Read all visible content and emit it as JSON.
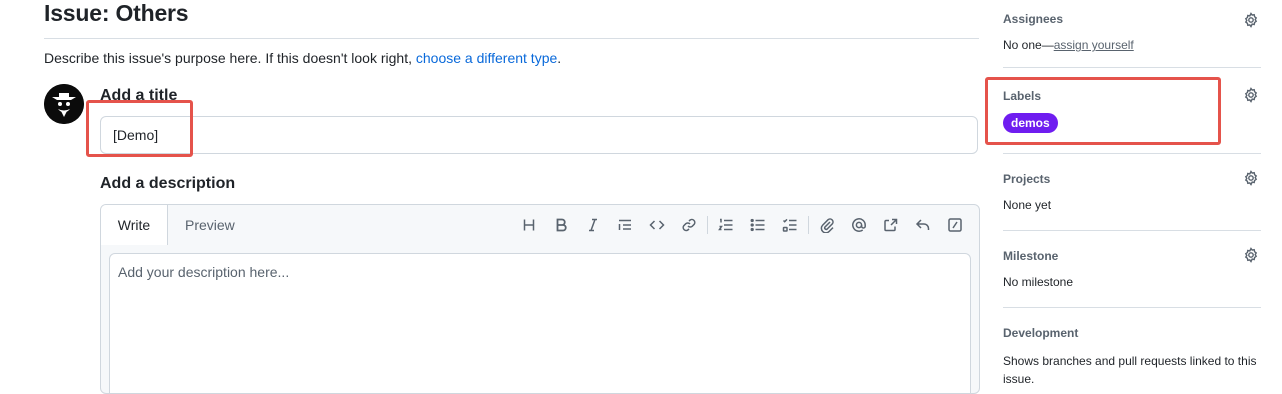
{
  "main": {
    "title": "Issue: Others",
    "description_prefix": "Describe this issue's purpose here. If this doesn't look right, ",
    "description_link": "choose a different type",
    "description_suffix": ".",
    "title_heading": "Add a title",
    "title_value": "[Demo]",
    "desc_heading": "Add a description",
    "tabs": [
      {
        "label": "Write"
      },
      {
        "label": "Preview"
      }
    ],
    "desc_placeholder": "Add your description here..."
  },
  "toolbar": [
    {
      "icon": "heading-icon"
    },
    {
      "icon": "bold-icon"
    },
    {
      "icon": "italic-icon"
    },
    {
      "icon": "quote-icon"
    },
    {
      "icon": "code-icon"
    },
    {
      "icon": "link-icon"
    },
    {
      "icon": "ordered-list-icon"
    },
    {
      "icon": "unordered-list-icon"
    },
    {
      "icon": "task-list-icon"
    },
    {
      "icon": "attach-icon"
    },
    {
      "icon": "mention-icon"
    },
    {
      "icon": "reference-icon"
    },
    {
      "icon": "reply-icon"
    },
    {
      "icon": "slash-commands-icon"
    }
  ],
  "sidebar": {
    "assignees": {
      "heading": "Assignees",
      "value_prefix": "No one—",
      "value_link": "assign yourself"
    },
    "labels": {
      "heading": "Labels",
      "items": [
        {
          "name": "demos",
          "color": "#6f1df0"
        }
      ]
    },
    "projects": {
      "heading": "Projects",
      "value": "None yet"
    },
    "milestone": {
      "heading": "Milestone",
      "value": "No milestone"
    },
    "development": {
      "heading": "Development",
      "value": "Shows branches and pull requests linked to this issue."
    }
  },
  "colors": {
    "link": "#0969da",
    "annotation": "#e5534b"
  }
}
